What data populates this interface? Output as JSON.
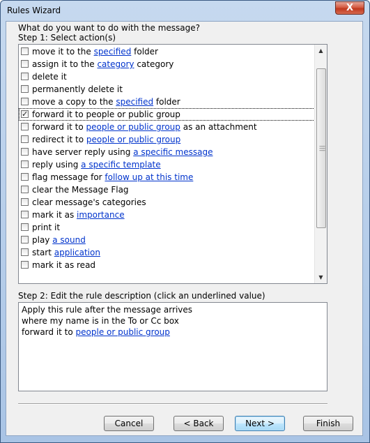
{
  "window": {
    "title": "Rules Wizard",
    "close_label": "X"
  },
  "prompt": "What do you want to do with the message?",
  "step1_label": "Step 1: Select action(s)",
  "actions": [
    {
      "parts": [
        "move it to the ",
        "specified",
        " folder"
      ],
      "checked": false
    },
    {
      "parts": [
        "assign it to the ",
        "category",
        " category"
      ],
      "checked": false
    },
    {
      "parts": [
        "delete it"
      ],
      "checked": false
    },
    {
      "parts": [
        "permanently delete it"
      ],
      "checked": false
    },
    {
      "parts": [
        "move a copy to the ",
        "specified",
        " folder"
      ],
      "checked": false
    },
    {
      "parts": [
        "forward it to people or public group"
      ],
      "checked": true
    },
    {
      "parts": [
        "forward it to ",
        "people or public group",
        " as an attachment"
      ],
      "checked": false
    },
    {
      "parts": [
        "redirect it to ",
        "people or public group"
      ],
      "checked": false
    },
    {
      "parts": [
        "have server reply using ",
        "a specific message"
      ],
      "checked": false
    },
    {
      "parts": [
        "reply using ",
        "a specific template"
      ],
      "checked": false
    },
    {
      "parts": [
        "flag message for ",
        "follow up at this time"
      ],
      "checked": false
    },
    {
      "parts": [
        "clear the Message Flag"
      ],
      "checked": false
    },
    {
      "parts": [
        "clear message's categories"
      ],
      "checked": false
    },
    {
      "parts": [
        "mark it as ",
        "importance"
      ],
      "checked": false
    },
    {
      "parts": [
        "print it"
      ],
      "checked": false
    },
    {
      "parts": [
        "play ",
        "a sound"
      ],
      "checked": false
    },
    {
      "parts": [
        "start ",
        "application"
      ],
      "checked": false
    },
    {
      "parts": [
        "mark it as read"
      ],
      "checked": false
    }
  ],
  "step2_label": "Step 2: Edit the rule description (click an underlined value)",
  "description": {
    "line1": "Apply this rule after the message arrives",
    "line2": "where my name is in the To or Cc box",
    "line3_prefix": "forward it to ",
    "line3_link": "people or public group"
  },
  "buttons": {
    "cancel": "Cancel",
    "back": "< Back",
    "next": "Next >",
    "finish": "Finish"
  }
}
